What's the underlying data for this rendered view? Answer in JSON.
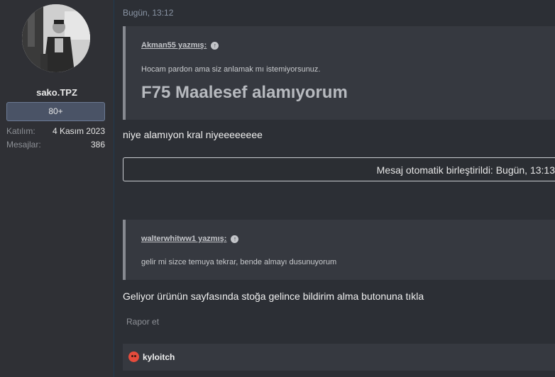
{
  "user": {
    "username": "sako.TPZ",
    "badge": "80+",
    "joined_label": "Katılım:",
    "joined_value": "4 Kasım 2023",
    "messages_label": "Mesajlar:",
    "messages_value": "386"
  },
  "post": {
    "timestamp": "Bugün, 13:12",
    "quote1": {
      "author": "Akman55 yazmış:",
      "text": "Hocam pardon ama siz anlamak mı istemiyorsunuz.",
      "big_text": "F75 Maalesef alamıyorum"
    },
    "reply1": "niye alamıyon kral niyeeeeeeee",
    "merged_notice": "Mesaj otomatik birleştirildi: Bugün, 13:13",
    "quote2": {
      "author": "walterwhitww1 yazmış:",
      "text": "gelir mi sizce temuya tekrar, bende almayı dusunuyorum"
    },
    "reply2": "Geliyor ürünün sayfasında stoğa gelince bildirim alma butonuna tıkla",
    "report_label": "Rapor et",
    "reaction_user": "kyloitch"
  },
  "colors": {
    "background": "#2c2f35",
    "sidebar": "#2f3035",
    "quote_bg": "#363940",
    "badge_bg": "#4a5366",
    "reaction_emoji": "#e54b3c"
  },
  "icons": {
    "quote_jump": "arrow-up-circle-icon",
    "reaction": "angry-face-icon"
  }
}
